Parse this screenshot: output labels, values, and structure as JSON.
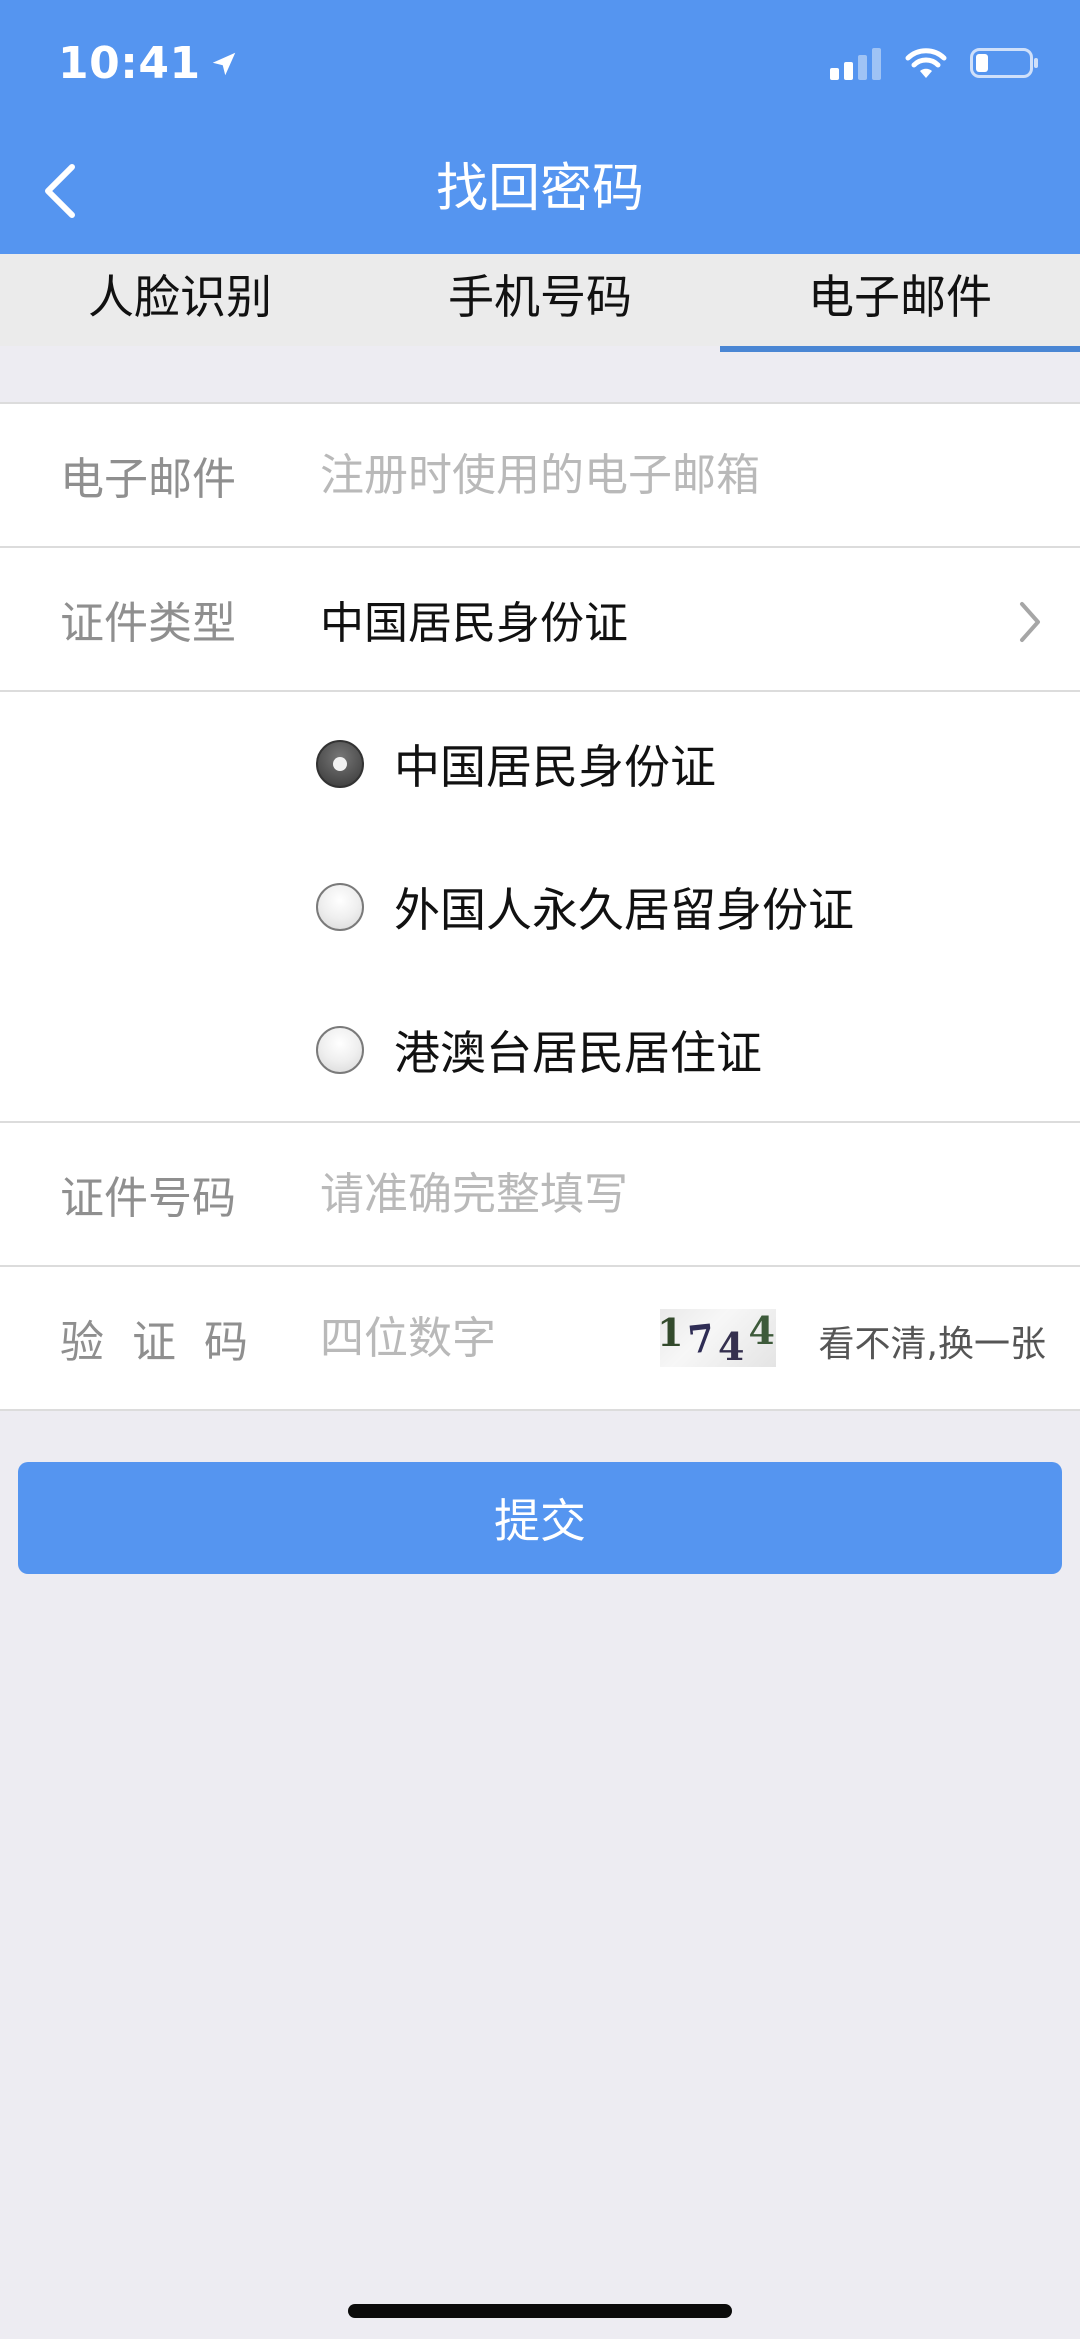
{
  "status_bar": {
    "time": "10:41"
  },
  "nav": {
    "title": "找回密码"
  },
  "tabs": [
    {
      "label": "人脸识别",
      "active": false
    },
    {
      "label": "手机号码",
      "active": false
    },
    {
      "label": "电子邮件",
      "active": true
    }
  ],
  "form": {
    "email": {
      "label": "电子邮件",
      "placeholder": "注册时使用的电子邮箱"
    },
    "id_type": {
      "label": "证件类型",
      "value": "中国居民身份证"
    },
    "id_type_options": [
      {
        "label": "中国居民身份证",
        "checked": true
      },
      {
        "label": "外国人永久居留身份证",
        "checked": false
      },
      {
        "label": "港澳台居民居住证",
        "checked": false
      }
    ],
    "id_number": {
      "label": "证件号码",
      "placeholder": "请准确完整填写"
    },
    "captcha": {
      "label": "验证码",
      "placeholder": "四位数字",
      "code": [
        "1",
        "7",
        "4",
        "4"
      ],
      "refresh": "看不清,换一张"
    }
  },
  "submit_label": "提交",
  "colors": {
    "primary": "#5595f0",
    "tab_indicator": "#4a86d4",
    "background": "#edecf2"
  }
}
